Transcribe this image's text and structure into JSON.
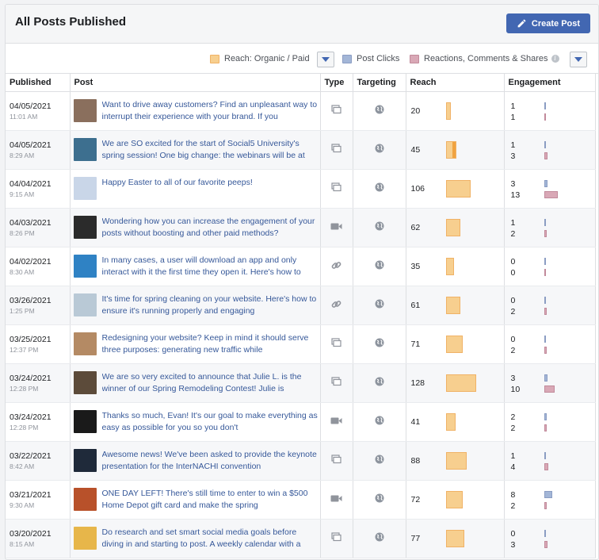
{
  "header": {
    "title": "All Posts Published",
    "create_label": "Create Post"
  },
  "legend": {
    "reach": "Reach: Organic / Paid",
    "clicks": "Post Clicks",
    "reactions": "Reactions, Comments & Shares",
    "info": "i"
  },
  "colors": {
    "organic": "#f7cf8f",
    "paid": "#f0a341",
    "clicks": "#a3b6d7",
    "reactions": "#d9a8b6",
    "brand": "#4267b2"
  },
  "columns": [
    "Published",
    "Post",
    "Type",
    "Targeting",
    "Reach",
    "Engagement"
  ],
  "rows": [
    {
      "date": "04/05/2021",
      "time": "11:01 AM",
      "text": "Want to drive away customers? Find an unpleasant way to interrupt their experience with your brand. If you",
      "type": "album-icon",
      "reach": 20,
      "paid": 0,
      "clicks": 1,
      "reactions": 1,
      "thumb": "#8a6f5d"
    },
    {
      "date": "04/05/2021",
      "time": "8:29 AM",
      "text": "We are SO excited for the start of Social5 University's spring session! One big change: the webinars will be at",
      "type": "album-icon",
      "reach": 45,
      "paid": 4,
      "clicks": 1,
      "reactions": 3,
      "thumb": "#3d6f8f"
    },
    {
      "date": "04/04/2021",
      "time": "9:15 AM",
      "text": "Happy Easter to all of our favorite peeps!",
      "type": "album-icon",
      "reach": 106,
      "paid": 0,
      "clicks": 3,
      "reactions": 13,
      "thumb": "#c9d6e8"
    },
    {
      "date": "04/03/2021",
      "time": "8:26 PM",
      "text": "Wondering how you can increase the engagement of your posts without boosting and other paid methods?",
      "type": "video-icon",
      "reach": 62,
      "paid": 0,
      "clicks": 1,
      "reactions": 2,
      "thumb": "#2b2b2b"
    },
    {
      "date": "04/02/2021",
      "time": "8:30 AM",
      "text": "In many cases, a user will download an app and only interact with it the first time they open it. Here's how to",
      "type": "link-icon",
      "reach": 35,
      "paid": 0,
      "clicks": 0,
      "reactions": 0,
      "thumb": "#2f82c4"
    },
    {
      "date": "03/26/2021",
      "time": "1:25 PM",
      "text": "It's time for spring cleaning on your website. Here's how to ensure it's running properly and engaging",
      "type": "link-icon",
      "reach": 61,
      "paid": 0,
      "clicks": 0,
      "reactions": 2,
      "thumb": "#b9c9d6"
    },
    {
      "date": "03/25/2021",
      "time": "12:37 PM",
      "text": "Redesigning your website? Keep in mind it should serve three purposes: generating new traffic while",
      "type": "album-icon",
      "reach": 71,
      "paid": 0,
      "clicks": 0,
      "reactions": 2,
      "thumb": "#b48a64"
    },
    {
      "date": "03/24/2021",
      "time": "12:28 PM",
      "text": "We are so very excited to announce that Julie L. is the winner of our Spring Remodeling Contest! Julie is",
      "type": "album-icon",
      "reach": 128,
      "paid": 0,
      "clicks": 3,
      "reactions": 10,
      "thumb": "#5c4b3a"
    },
    {
      "date": "03/24/2021",
      "time": "12:28 PM",
      "text": "Thanks so much, Evan! It's our goal to make everything as easy as possible for you so you don't",
      "type": "video-icon",
      "reach": 41,
      "paid": 0,
      "clicks": 2,
      "reactions": 2,
      "thumb": "#1a1a1a"
    },
    {
      "date": "03/22/2021",
      "time": "8:42 AM",
      "text": "Awesome news! We've been asked to provide the keynote presentation for the InterNACHI convention",
      "type": "album-icon",
      "reach": 88,
      "paid": 0,
      "clicks": 1,
      "reactions": 4,
      "thumb": "#1f2a3a"
    },
    {
      "date": "03/21/2021",
      "time": "9:30 AM",
      "text": "ONE DAY LEFT! There's still time to enter to win a $500 Home Depot gift card and make the spring",
      "type": "video-icon",
      "reach": 72,
      "paid": 0,
      "clicks": 8,
      "reactions": 2,
      "thumb": "#b8512a"
    },
    {
      "date": "03/20/2021",
      "time": "8:15 AM",
      "text": "Do research and set smart social media goals before diving in and starting to post. A weekly calendar with a",
      "type": "album-icon",
      "reach": 77,
      "paid": 0,
      "clicks": 0,
      "reactions": 3,
      "thumb": "#e7b64a"
    }
  ]
}
